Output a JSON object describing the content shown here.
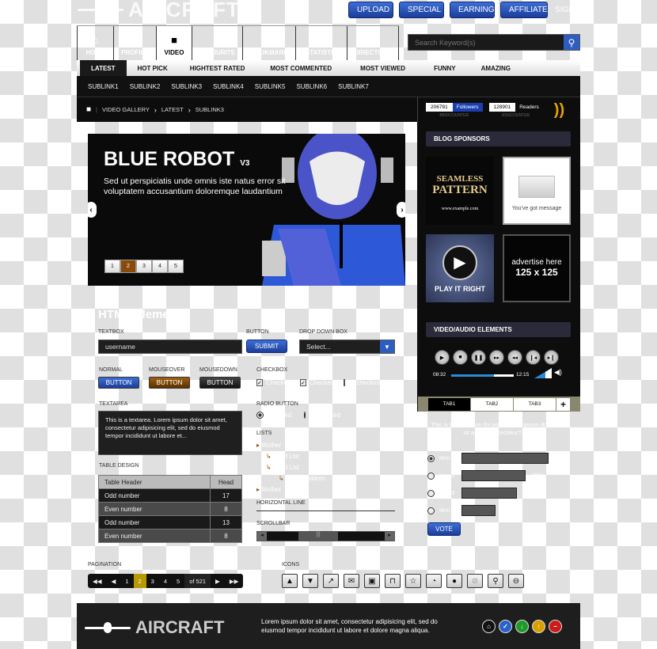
{
  "header": {
    "logo": "AIRCRAFT",
    "top_buttons": [
      "UPLOAD",
      "SPECIAL",
      "EARNING",
      "AFFILIATE"
    ],
    "signon": "SIGNO",
    "nav": [
      {
        "label": "HOME",
        "icon": "home-icon"
      },
      {
        "label": "PROFILE",
        "icon": "user-icon"
      },
      {
        "label": "VIDEO",
        "icon": "video-camera-icon"
      },
      {
        "label": "FAVOURITE",
        "icon": "heart-icon"
      },
      {
        "label": "BOOKMARK",
        "icon": "bookmark-icon"
      },
      {
        "label": "STATISTIC",
        "icon": "chart-icon"
      },
      {
        "label": "DIRECTORY",
        "icon": "folder-icon"
      }
    ],
    "search_placeholder": "Search Keyword(s)"
  },
  "tabs": [
    "LATEST",
    "HOT PICK",
    "HIGHTEST RATED",
    "MOST COMMENTED",
    "MOST VIEWED",
    "FUNNY",
    "AMAZING"
  ],
  "sublinks": [
    "SUBLINK1",
    "SUBLINK2",
    "SUBLINK3",
    "SUBLINK4",
    "SUBLINK5",
    "SUBLINK6",
    "SUBLINK7"
  ],
  "breadcrumb": [
    "VIDEO GALLERY",
    "LATEST",
    "SUBLINK3"
  ],
  "counters": {
    "followers": {
      "value": "206781",
      "label": "Followers",
      "caption": "BIRDCOUNTER"
    },
    "readers": {
      "value": "128901",
      "label": "Readers",
      "caption": "RSSCOUNTER"
    }
  },
  "slider": {
    "title": "BLUE ROBOT",
    "version": "V3",
    "text": "Sed ut perspiciatis unde omnis iste natus error sit voluptatem accusantium doloremque laudantium",
    "pages": [
      "1",
      "2",
      "3",
      "4",
      "5"
    ],
    "active_page": "2"
  },
  "sponsors": {
    "title": "BLOG SPONSORS",
    "ad1": {
      "line1": "SEAMLESS",
      "line2": "PATTERN",
      "url": "www.example.com"
    },
    "ad2": {
      "text": "You've got message"
    },
    "ad3": {
      "text": "PLAY IT RIGHT"
    },
    "ad4": {
      "line1": "advertise here",
      "line2": "125 x 125"
    }
  },
  "media": {
    "title": "VIDEO/AUDIO ELEMENTS",
    "current_time": "08:32",
    "total_time": "12:15",
    "progress": 0.68,
    "tabs": [
      "TAB1",
      "TAB2",
      "TAB3",
      "+"
    ]
  },
  "elements": {
    "heading": "HTML Elements",
    "textbox_label": "TEXTBOX",
    "textbox_value": "username",
    "button_label": "BUTTON",
    "submit": "SUBMIT",
    "dropdown_label": "DROP DOWN BOX",
    "dropdown_value": "Select...",
    "states": [
      {
        "label": "NORMAL",
        "button": "BUTTON"
      },
      {
        "label": "MOUSEOVER",
        "button": "BUTTON"
      },
      {
        "label": "MOUSEDOWN",
        "button": "BUTTON"
      }
    ],
    "checkbox_label": "CHECKBOX",
    "checkboxes": [
      {
        "text": "Checked",
        "checked": true
      },
      {
        "text": "Checked",
        "checked": true
      },
      {
        "text": "Unchecked",
        "checked": false
      }
    ],
    "radio_label": "RADIO BUTTON",
    "radios": [
      {
        "text": "Selected",
        "on": true
      },
      {
        "text": "Unselected",
        "on": false
      }
    ],
    "textarea_label": "TEXTAREA",
    "textarea_value": "This is a textarea. Lorem ipsum dolor sit amet, consectetur adipisicing elit, sed do eiusmod tempor incididunt ut labore et...",
    "table_label": "TABLE DESIGN",
    "table": {
      "headers": [
        "Table Header",
        "Head"
      ],
      "rows": [
        [
          "Odd number",
          "17"
        ],
        [
          "Even number",
          "8"
        ],
        [
          "Odd number",
          "13"
        ],
        [
          "Even number",
          "8"
        ]
      ]
    },
    "lists_label": "LISTS",
    "lists": [
      "Mother",
      "Child List",
      "Child List",
      "Grandchildren",
      "Mother"
    ],
    "hline_label": "HORIZONTAL LINE",
    "scrollbar_label": "SCROLLBAR",
    "pagination_label": "PAGINATION",
    "pagination": {
      "pages": [
        "1",
        "2",
        "3",
        "4",
        "5"
      ],
      "active": "2",
      "total": "of 521"
    },
    "icons_label": "ICONS",
    "icons": [
      "arrow-up-icon",
      "arrow-down-icon",
      "arrow-diagonal-icon",
      "mail-icon",
      "lock-icon",
      "unlock-icon",
      "star-icon",
      "rss-icon",
      "comment-icon",
      "paperclip-icon",
      "search-icon",
      "minus-circle-icon"
    ]
  },
  "poll": {
    "question": "This is the question for poll. Lorem ipsum dolor sit amet, consectetur?",
    "items": [
      {
        "label": "Item 1",
        "value": 1.0,
        "selected": true
      },
      {
        "label": "Item 2",
        "value": 0.74,
        "pct": "28%",
        "selected": false
      },
      {
        "label": "Item 3",
        "value": 0.64,
        "selected": false
      },
      {
        "label": "Item 4",
        "value": 0.39,
        "selected": false
      }
    ],
    "vote": "VOTE"
  },
  "footer": {
    "logo": "AIRCRAFT",
    "text": "Lorem ipsum dolor sit amet, consectetur adipisicing elit, sed do eiusmod tempor incididunt ut labore et dolore magna aliqua.",
    "icons": [
      {
        "name": "home-icon",
        "color": "#111111",
        "glyph": "⌂"
      },
      {
        "name": "check-icon",
        "color": "#2a62c9",
        "glyph": "✓"
      },
      {
        "name": "download-icon",
        "color": "#1f9a2a",
        "glyph": "↓"
      },
      {
        "name": "upload-icon",
        "color": "#d6a000",
        "glyph": "↑"
      },
      {
        "name": "remove-icon",
        "color": "#cc1b1b",
        "glyph": "−"
      }
    ]
  }
}
